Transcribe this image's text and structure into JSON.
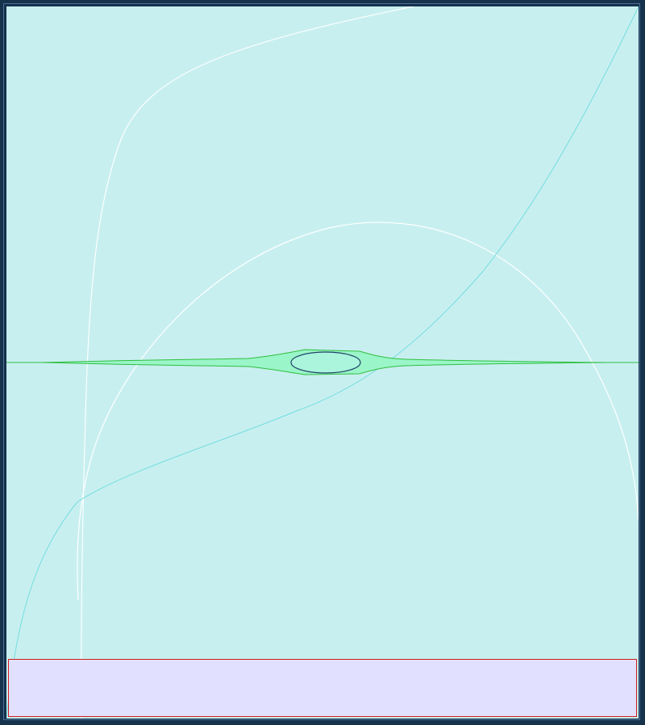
{
  "colors": {
    "window_frame": "#16324d",
    "canvas_background": "#c8eff0",
    "white_curve": "#ffffff",
    "cyan_curve": "#74dede",
    "green_shape_fill": "#9af5c8",
    "green_shape_stroke": "#2fbf3f",
    "ellipse_fill": "#aaf5dc",
    "ellipse_stroke": "#20406a",
    "bottom_panel_fill": "#e2e0ff",
    "bottom_panel_border": "#d01c1c"
  },
  "icons": {
    "curve_widget": "curve-plot-icon"
  }
}
